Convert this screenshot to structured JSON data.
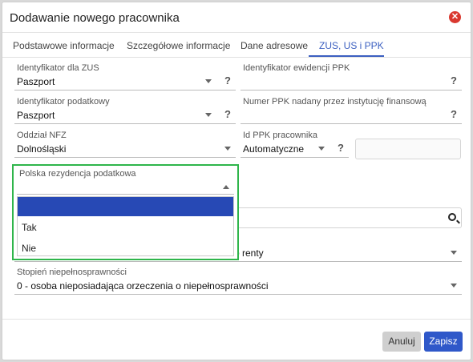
{
  "dialog": {
    "title": "Dodawanie nowego pracownika"
  },
  "tabs": [
    {
      "label": "Podstawowe informacje"
    },
    {
      "label": "Szczegółowe informacje"
    },
    {
      "label": "Dane adresowe"
    },
    {
      "label": "ZUS, US i PPK",
      "active": true
    }
  ],
  "fields": {
    "zus_id": {
      "label": "Identyfikator dla ZUS",
      "value": "Paszport"
    },
    "ppk_register_id": {
      "label": "Identyfikator ewidencji PPK",
      "value": ""
    },
    "tax_id": {
      "label": "Identyfikator podatkowy",
      "value": "Paszport"
    },
    "ppk_number": {
      "label": "Numer PPK nadany przez instytucję finansową",
      "value": ""
    },
    "nfz": {
      "label": "Oddział NFZ",
      "value": "Dolnośląski"
    },
    "ppk_employee_id": {
      "label": "Id PPK pracownika",
      "value": "Automatyczne"
    },
    "pension_type": {
      "value": "b renty"
    },
    "disability": {
      "label": "Stopień niepełnosprawności",
      "value": "0 - osoba nieposiadająca orzeczenia o niepełnosprawności"
    }
  },
  "residency_dropdown": {
    "label": "Polska rezydencja podatkowa",
    "value": "",
    "options": [
      "",
      "Tak",
      "Nie"
    ],
    "highlighted_index": 0
  },
  "buttons": {
    "cancel": "Anuluj",
    "save": "Zapisz"
  },
  "help_glyph": "?",
  "colors": {
    "accent": "#2f58c9",
    "highlight": "#2749b5",
    "focus_outline": "#2fb54b",
    "close": "#d9382f"
  },
  "icons": [
    "close-icon",
    "chevron-down-icon",
    "chevron-up-icon",
    "help-icon",
    "search-icon"
  ]
}
